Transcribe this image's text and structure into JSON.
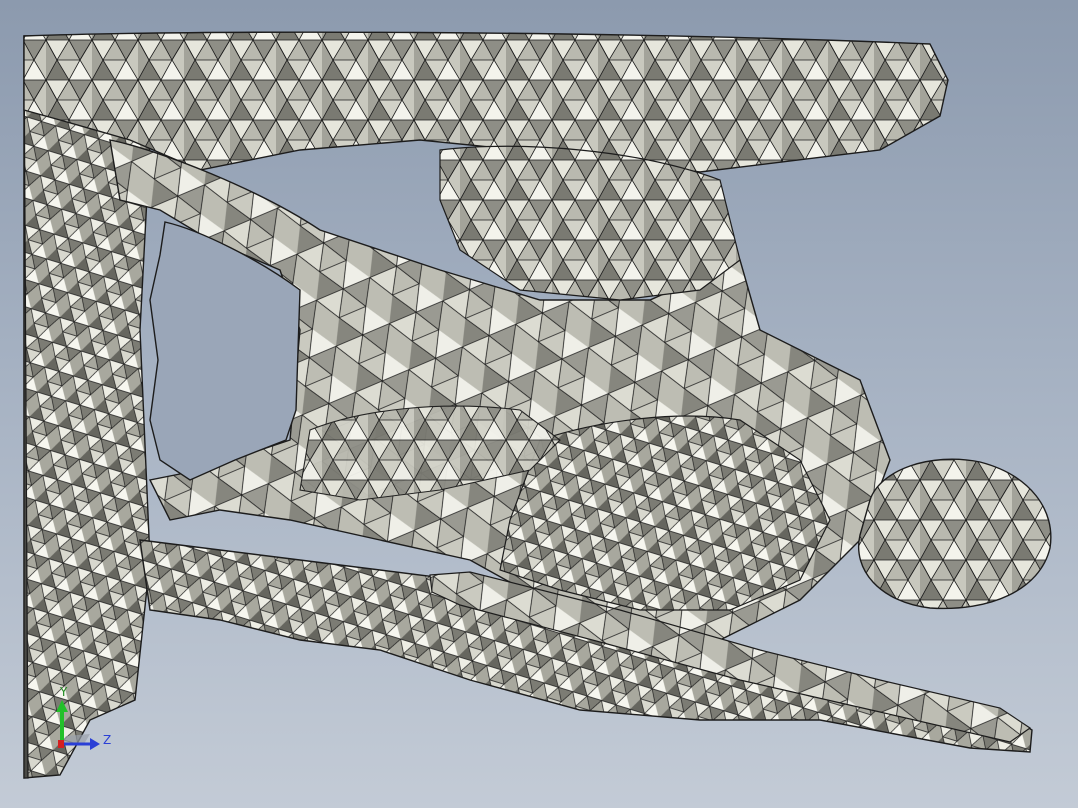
{
  "viewport": {
    "background_top": "#8c9aae",
    "background_bottom": "#c3cbd6",
    "mesh_fill_light": "#e4e4da",
    "mesh_fill_mid": "#b6b6ac",
    "mesh_fill_dark": "#6e6e68",
    "mesh_edge": "#1c1c1c"
  },
  "triad": {
    "y_label": "Y",
    "z_label": "Z",
    "y_color": "#22c02a",
    "z_color": "#2a3fd6",
    "x_color": "#d42020"
  }
}
